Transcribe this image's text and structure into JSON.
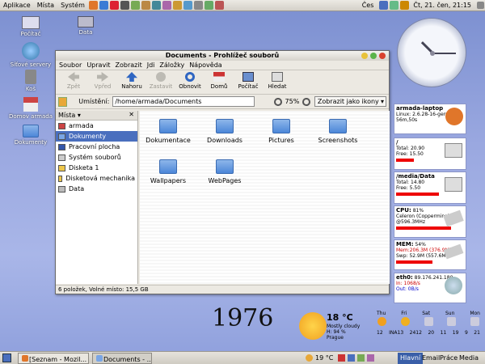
{
  "top_panel": {
    "menus": [
      "Aplikace",
      "Místa",
      "Systém"
    ],
    "keyboard": "Čes",
    "datetime": "Čt, 21. čen, 21:15"
  },
  "desktop_icons": [
    "Počítač",
    "Data",
    "Síťové servery",
    "Koš",
    "Domov armada",
    "Dokumenty"
  ],
  "window": {
    "title": "Documents - Prohlížeč souborů",
    "menu": [
      "Soubor",
      "Upravit",
      "Zobrazit",
      "Jdi",
      "Záložky",
      "Nápověda"
    ],
    "toolbar": [
      {
        "label": "Zpět",
        "enabled": false
      },
      {
        "label": "Vpřed",
        "enabled": false
      },
      {
        "label": "Nahoru",
        "enabled": true
      },
      {
        "label": "Zastavit",
        "enabled": false
      },
      {
        "label": "Obnovit",
        "enabled": true
      },
      {
        "label": "Domů",
        "enabled": true
      },
      {
        "label": "Počítač",
        "enabled": true
      },
      {
        "label": "Hledat",
        "enabled": true
      }
    ],
    "location_label": "Umístění:",
    "location": "/home/armada/Documents",
    "zoom": "75%",
    "view_mode": "Zobrazit jako ikony",
    "sidebar_title": "Místa",
    "sidebar": [
      "armada",
      "Dokumenty",
      "Pracovní plocha",
      "Systém souborů",
      "Disketa 1",
      "Disketová mechanika",
      "Data"
    ],
    "files": [
      "Dokumentace",
      "Downloads",
      "Pictures",
      "Screenshots",
      "Wallpapers",
      "WebPages"
    ],
    "status": "6 položek, Volné místo: 15,5 GB"
  },
  "monitors": {
    "host": {
      "name": "armada-laptop",
      "info": "Linux: 2.6.28-16-generic",
      "uptime": "56m,50s"
    },
    "root": {
      "mount": "/",
      "total": "Total: 20.90",
      "free": "Free: 15.50",
      "used_fraction": 0.26
    },
    "data": {
      "mount": "/media/Data",
      "total": "Total: 14.80",
      "free": "Free: 5.50",
      "used_fraction": 0.63
    },
    "cpu": {
      "label": "CPU:",
      "value": "81%",
      "model": "Celeron (Coppermine)",
      "freq": "@596.3MHz",
      "fraction": 0.81
    },
    "mem": {
      "label": "MEM:",
      "value": "54%",
      "ram": "Mem:206.3M (376.9M)",
      "swap": "Swp: 52.9M (557.6M)",
      "fraction": 0.54
    },
    "net": {
      "label": "eth0:",
      "ip": "89.176.241.180",
      "in": "In:    1068/s",
      "out": "Out:   0B/s"
    }
  },
  "year": "1976",
  "weather": {
    "temp": "18 °C",
    "desc": "Mostly cloudy",
    "humidity": "H: 94 %",
    "city": "Prague",
    "days": [
      "Thu",
      "Fri",
      "Sat",
      "Sun",
      "Mon"
    ],
    "temps": [
      "12",
      "INA13",
      "2412",
      "20",
      "11",
      "19",
      "9",
      "21"
    ]
  },
  "taskbar": [
    "[Seznam - Mozil...",
    "Documents - ..."
  ],
  "tray": {
    "temp": "19 °C",
    "clock": "21:15",
    "workspaces": [
      "Hlavní",
      "Email",
      "Práce",
      "Media"
    ]
  },
  "colors": {
    "selection": "#4a6fbe",
    "bar": "#e00000",
    "desktop": "#9aa8e0"
  }
}
